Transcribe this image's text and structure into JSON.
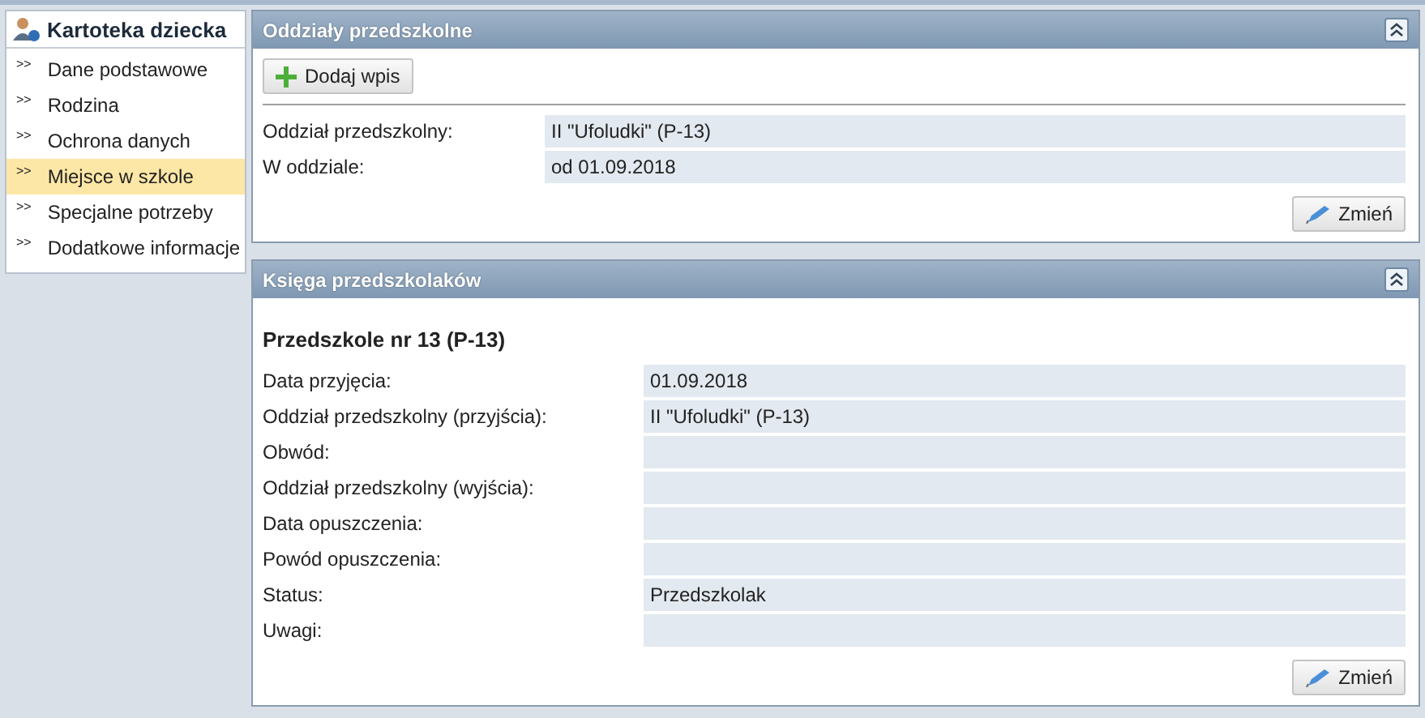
{
  "sidebar": {
    "title": "Kartoteka dziecka",
    "items": [
      {
        "marker": ">>",
        "label": "Dane podstawowe",
        "selected": false
      },
      {
        "marker": ">>",
        "label": "Rodzina",
        "selected": false
      },
      {
        "marker": ">>",
        "label": "Ochrona danych",
        "selected": false
      },
      {
        "marker": ">>",
        "label": "Miejsce w szkole",
        "selected": true
      },
      {
        "marker": ">>",
        "label": "Specjalne potrzeby",
        "selected": false
      },
      {
        "marker": ">>",
        "label": "Dodatkowe informacje",
        "selected": false
      }
    ]
  },
  "panels": [
    {
      "title": "Oddziały przedszkolne",
      "add_button": "Dodaj wpis",
      "fields": [
        {
          "label": "Oddział przedszkolny:",
          "value": "II \"Ufoludki\" (P-13)"
        },
        {
          "label": "W oddziale:",
          "value": "od 01.09.2018"
        }
      ],
      "edit_button": "Zmień"
    },
    {
      "title": "Księga przedszkolaków",
      "heading": "Przedszkole nr 13 (P-13)",
      "fields": [
        {
          "label": "Data przyjęcia:",
          "value": "01.09.2018"
        },
        {
          "label": "Oddział przedszkolny (przyjścia):",
          "value": "II \"Ufoludki\" (P-13)"
        },
        {
          "label": "Obwód:"
        },
        {
          "label": "Oddział przedszkolny (wyjścia):"
        },
        {
          "label": "Data opuszczenia:"
        },
        {
          "label": "Powód opuszczenia:"
        },
        {
          "label": "Status:",
          "value": "Przedszkolak"
        },
        {
          "label": "Uwagi:"
        }
      ],
      "edit_button": "Zmień"
    }
  ]
}
